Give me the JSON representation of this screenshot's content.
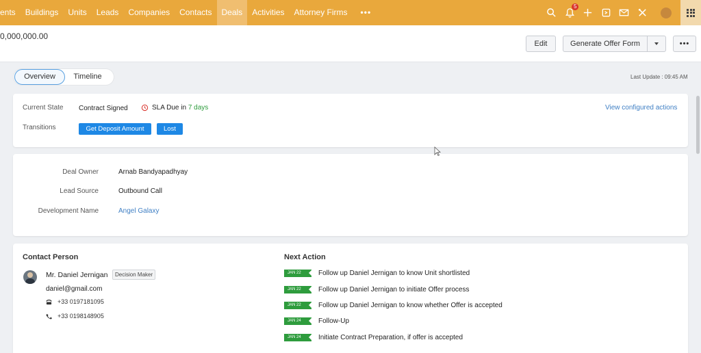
{
  "nav": {
    "items": [
      "ents",
      "Buildings",
      "Units",
      "Leads",
      "Companies",
      "Contacts",
      "Deals",
      "Activities",
      "Attorney Firms",
      "•••"
    ],
    "active": "Deals",
    "notification_count": "5",
    "icons": [
      "search-icon",
      "bell-icon",
      "plus-icon",
      "inbox-icon",
      "mail-icon",
      "tools-icon",
      "avatar-icon",
      "apps-grid-icon"
    ]
  },
  "header": {
    "amount": "0,000,000.00",
    "edit_label": "Edit",
    "offer_label": "Generate Offer Form",
    "more_label": "•••"
  },
  "tabs": {
    "overview": "Overview",
    "timeline": "Timeline",
    "last_update": "Last Update : 09:45 AM"
  },
  "state": {
    "current_state_label": "Current State",
    "current_state_value": "Contract Signed",
    "sla_prefix": "SLA Due in ",
    "sla_days": "7 days",
    "configured_link": "View configured actions",
    "transitions_label": "Transitions",
    "transition_buttons": [
      "Get Deposit Amount",
      "Lost"
    ]
  },
  "details": {
    "fields": [
      {
        "label": "Deal Owner",
        "value": "Arnab Bandyapadhyay"
      },
      {
        "label": "Lead Source",
        "value": "Outbound Call"
      },
      {
        "label": "Development Name",
        "value": "Angel Galaxy"
      }
    ]
  },
  "contact": {
    "title": "Contact Person",
    "name": "Mr. Daniel Jernigan",
    "role": "Decision Maker",
    "email": "daniel@gmail.com",
    "phones": [
      "+33 0197181095",
      "+33 0198148905"
    ]
  },
  "next_action": {
    "title": "Next Action",
    "items": [
      {
        "date": "JAN 22",
        "text": "Follow up Daniel Jernigan to know Unit shortlisted"
      },
      {
        "date": "JAN 22",
        "text": "Follow up Daniel Jernigan to initiate Offer process"
      },
      {
        "date": "JAN 22",
        "text": "Follow up Daniel Jernigan to know whether Offer is accepted"
      },
      {
        "date": "JAN 24",
        "text": "Follow-Up"
      },
      {
        "date": "JAN 24",
        "text": "Initiate Contract Preparation, if offer is accepted"
      }
    ]
  },
  "colors": {
    "nav_bg": "#e9a83c",
    "accent_blue": "#1e88e5",
    "link_blue": "#3f7fc4",
    "green": "#2e9c3d"
  }
}
